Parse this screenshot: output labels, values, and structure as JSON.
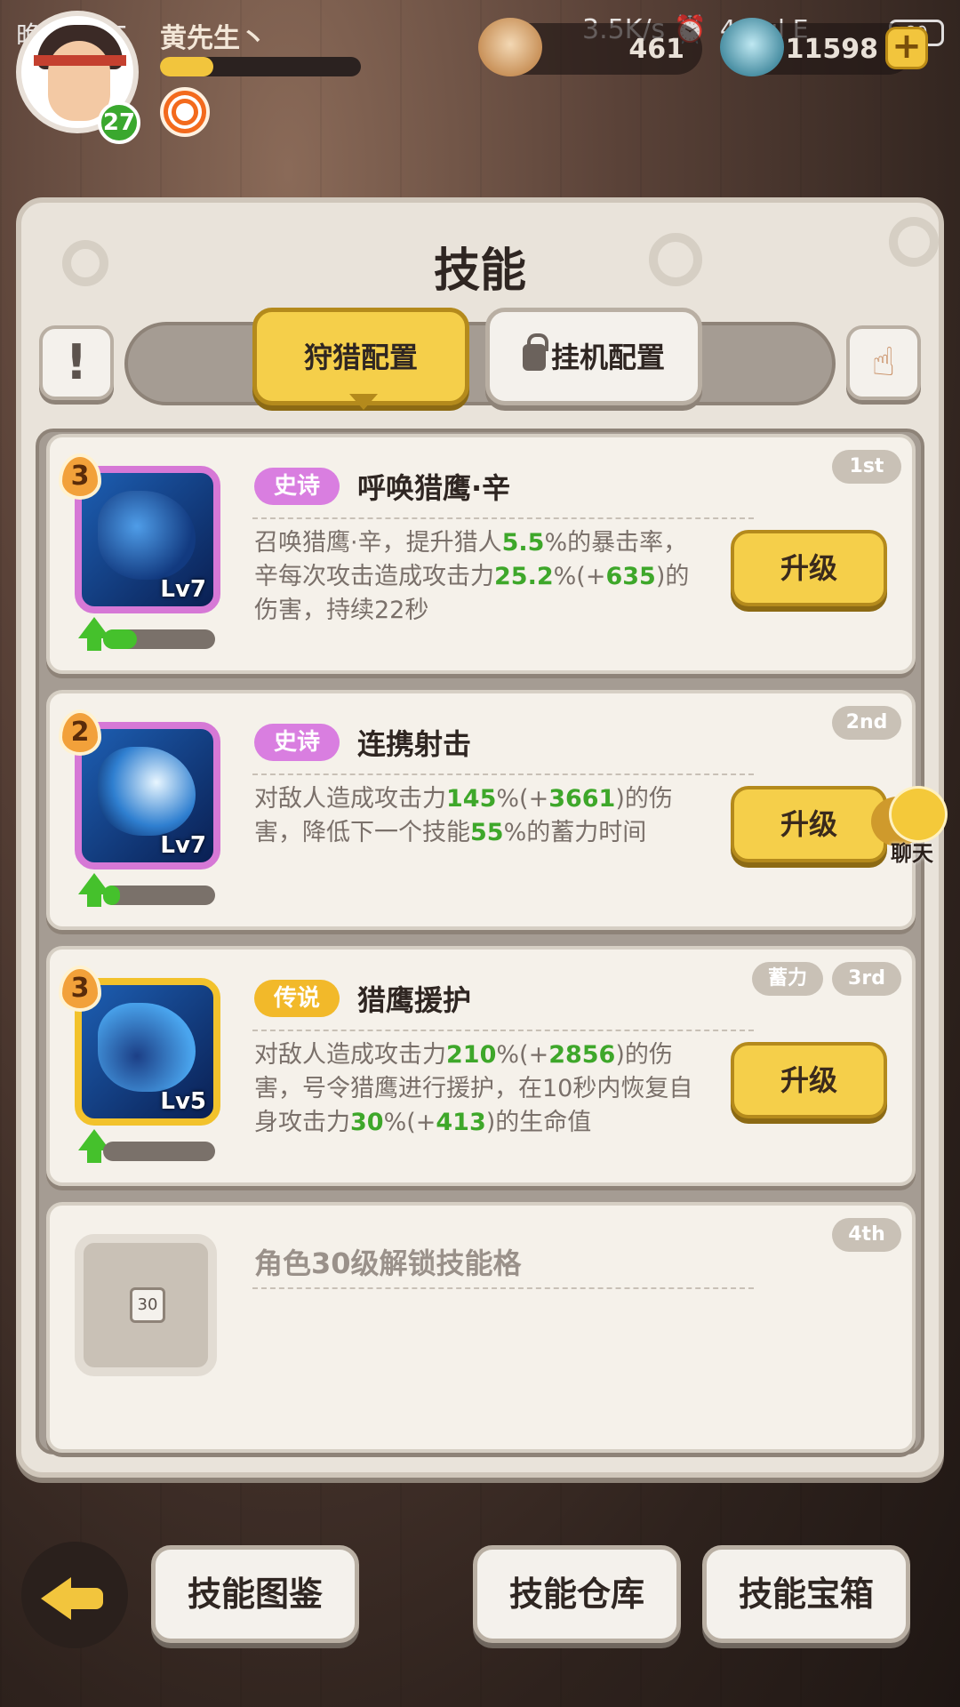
{
  "status": {
    "time": "晚上8:25",
    "network": "3.5K/s ⏰",
    "signal": "4G .ıl E",
    "battery": "89"
  },
  "player": {
    "name": "黄先生丶",
    "level": "27",
    "xp_fraction": 0.27
  },
  "currencies": {
    "shells": "461",
    "gems": "11598",
    "add": "+"
  },
  "panel": {
    "title": "技能"
  },
  "tabs": {
    "hunt": "狩猎配置",
    "idle": "挂机配置"
  },
  "icons": {
    "info": "!",
    "gesture": "☝"
  },
  "skills": [
    {
      "star": "3",
      "level": "Lv7",
      "rarity": "史诗",
      "name": "呼唤猎鹰·辛",
      "rank": "1st",
      "upgrade": "升级",
      "progress": 0.3,
      "desc_pre": "召唤猎鹰·辛，提升猎人",
      "v1": "5.5",
      "desc_mid1": "%的暴击率，辛每次攻击造成攻击力",
      "v2": "25.2",
      "desc_mid2": "%(+",
      "v3": "635",
      "desc_post": ")的伤害，持续22秒"
    },
    {
      "star": "2",
      "level": "Lv7",
      "rarity": "史诗",
      "name": "连携射击",
      "rank": "2nd",
      "upgrade": "升级",
      "progress": 0.15,
      "desc_pre": "对敌人造成攻击力",
      "v1": "145",
      "desc_mid1": "%(+",
      "v2": "3661",
      "desc_mid2": ")的伤害，降低下一个技能",
      "v3": "55",
      "desc_post": "%的蓄力时间"
    },
    {
      "star": "3",
      "level": "Lv5",
      "rarity": "传说",
      "name": "猎鹰援护",
      "rank": "3rd",
      "tag": "蓄力",
      "upgrade": "升级",
      "progress": 0.0,
      "desc_pre": "对敌人造成攻击力",
      "v1": "210",
      "desc_mid1": "%(+",
      "v2": "2856",
      "desc_mid2": ")的伤害，号令猎鹰进行援护，在10秒内恢复自身攻击力",
      "v3": "30",
      "desc_mid3": "%(+",
      "v4": "413",
      "desc_post": ")的生命值"
    }
  ],
  "locked_slot": {
    "text": "角色30级解锁技能格",
    "rank": "4th",
    "lock_level": "30"
  },
  "chat": {
    "label": "聊天"
  },
  "bottom_nav": {
    "codex": "技能图鉴",
    "storage": "技能仓库",
    "chest": "技能宝箱"
  }
}
